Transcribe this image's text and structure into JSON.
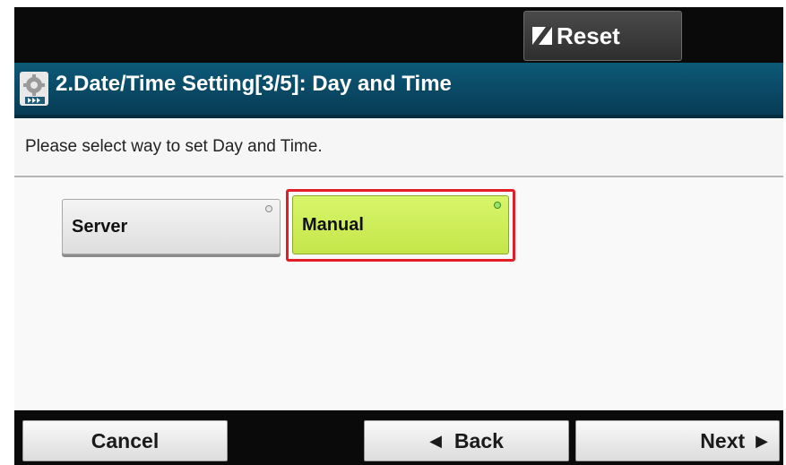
{
  "topbar": {
    "reset_label": "Reset"
  },
  "titlebar": {
    "title": "2.Date/Time Setting[3/5]: Day and Time"
  },
  "message": {
    "text": "Please select way to set Day and Time."
  },
  "options": {
    "server_label": "Server",
    "manual_label": "Manual",
    "selected": "Manual"
  },
  "bottombar": {
    "cancel_label": "Cancel",
    "back_label": "Back",
    "next_label": "Next"
  },
  "icons": {
    "reset": "reset-icon",
    "settings": "settings-gear-icon",
    "back": "triangle-left-icon",
    "next": "triangle-right-icon"
  },
  "colors": {
    "titlebar": "#0a4a66",
    "selected_option": "#c4e64a",
    "selection_outline": "#e21f26"
  }
}
